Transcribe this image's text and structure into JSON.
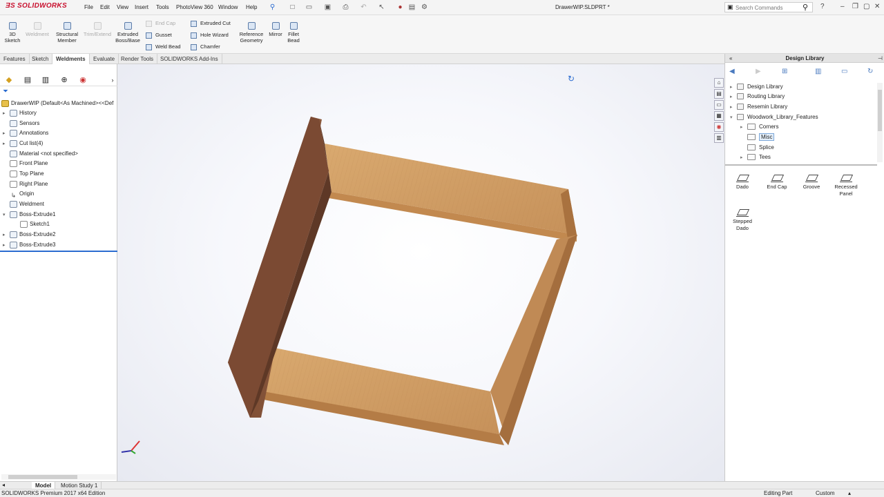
{
  "app": {
    "logo_text": "SOLIDWORKS",
    "document_title": "DrawerWIP.SLDPRT *",
    "search_placeholder": "Search Commands"
  },
  "menu": [
    "File",
    "Edit",
    "View",
    "Insert",
    "Tools",
    "PhotoView 360",
    "Window",
    "Help"
  ],
  "ribbon": {
    "sketch3d": "3D\nSketch",
    "weldment": "Weldment",
    "structural_member": "Structural\nMember",
    "trim_extend": "Trim/Extend",
    "extruded_boss": "Extruded\nBoss/Base",
    "end_cap": "End Cap",
    "gusset": "Gusset",
    "weld_bead": "Weld Bead",
    "extruded_cut": "Extruded Cut",
    "hole_wizard": "Hole Wizard",
    "chamfer": "Chamfer",
    "reference_geometry": "Reference\nGeometry",
    "mirror": "Mirror",
    "fillet_bead": "Fillet\nBead"
  },
  "command_tabs": [
    "Features",
    "Sketch",
    "Weldments",
    "Evaluate",
    "Render Tools",
    "SOLIDWORKS Add-Ins"
  ],
  "active_tab": "Weldments",
  "feature_tree": {
    "root": "DrawerWIP  (Default<As Machined><<Def",
    "items": [
      {
        "label": "History",
        "icon": "history-icon"
      },
      {
        "label": "Sensors",
        "icon": "sensor-icon"
      },
      {
        "label": "Annotations",
        "icon": "annotation-icon"
      },
      {
        "label": "Cut list(4)",
        "icon": "cutlist-icon"
      },
      {
        "label": "Material <not specified>",
        "icon": "material-icon"
      },
      {
        "label": "Front Plane",
        "icon": "plane-icon"
      },
      {
        "label": "Top Plane",
        "icon": "plane-icon"
      },
      {
        "label": "Right Plane",
        "icon": "plane-icon"
      },
      {
        "label": "Origin",
        "icon": "origin-icon"
      },
      {
        "label": "Weldment",
        "icon": "weldment-icon"
      },
      {
        "label": "Boss-Extrude1",
        "icon": "extrude-icon"
      },
      {
        "label": "Sketch1",
        "icon": "sketch-icon"
      },
      {
        "label": "Boss-Extrude2",
        "icon": "extrude-icon"
      },
      {
        "label": "Boss-Extrude3",
        "icon": "extrude-icon"
      }
    ]
  },
  "design_library": {
    "title": "Design Library",
    "tree": [
      {
        "label": "Design Library"
      },
      {
        "label": "Routing Library"
      },
      {
        "label": "Resemin Library"
      },
      {
        "label": "Woodwork_Library_Features"
      },
      {
        "label": "Corners"
      },
      {
        "label": "Misc"
      },
      {
        "label": "Splice"
      },
      {
        "label": "Tees"
      }
    ],
    "selected": "Misc",
    "features": [
      "Dado",
      "End Cap",
      "Groove",
      "Recessed\nPanel",
      "Stepped\nDado"
    ]
  },
  "bottom_tabs": [
    "Model",
    "Motion Study 1"
  ],
  "status": {
    "edition": "SOLIDWORKS Premium 2017 x64 Edition",
    "mode": "Editing Part",
    "units": "Custom"
  },
  "colors": {
    "brand": "#c8102e",
    "wood_light": "#d3a06a",
    "wood_dark": "#7a4a32",
    "accent": "#2a6bd0"
  }
}
